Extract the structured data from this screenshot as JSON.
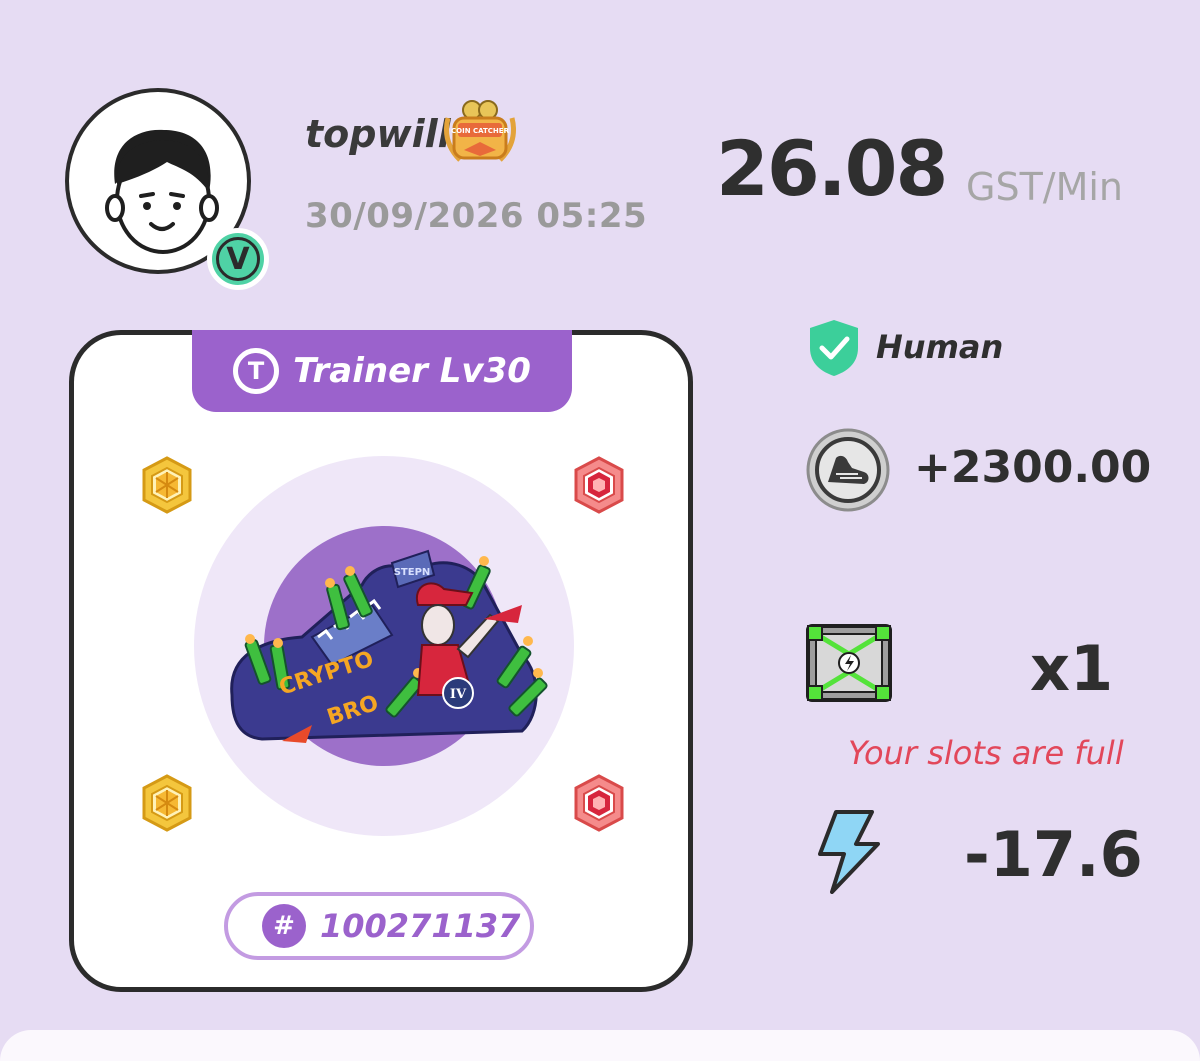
{
  "profile": {
    "username": "topwill",
    "datetime": "30/09/2026 05:25",
    "verified_badge_letter": "V",
    "achievement_badge_text": "COIN CATCHER"
  },
  "earnings": {
    "rate_value": "26.08",
    "rate_unit": "GST/Min"
  },
  "sneaker": {
    "level_label": "Trainer Lv30",
    "level_icon_letter": "T",
    "id_prefix": "#",
    "id_number": "100271137",
    "art_texts": [
      "CRYPTO",
      "BRO",
      "IV",
      "STEPN"
    ],
    "gem_slots": [
      "yellow-gem",
      "red-gem",
      "yellow-gem",
      "red-gem"
    ]
  },
  "status": {
    "human_label": "Human",
    "earned_amount": "+2300.00",
    "mystery_box_count": "x1",
    "slots_message": "Your slots are full",
    "energy_value": "-17.6"
  },
  "colors": {
    "background": "#e6dcf3",
    "accent_purple": "#9b62cc",
    "verified_green": "#4fd2a5",
    "warning_red": "#e2475a",
    "energy_blue": "#8fd6f5"
  }
}
